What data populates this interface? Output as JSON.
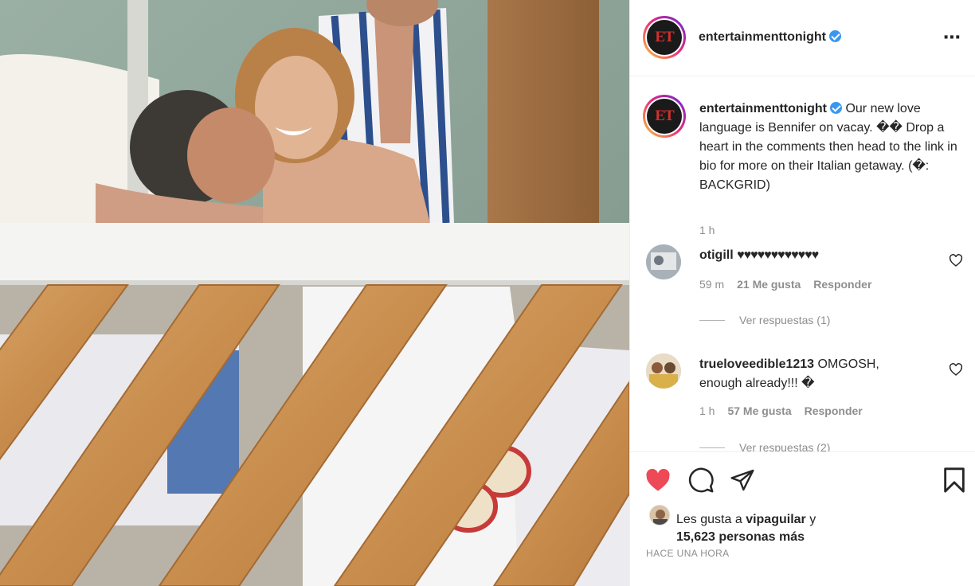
{
  "post": {
    "username": "entertainmenttonight",
    "avatar_text": "ET",
    "more_icon": "⋯",
    "caption_text": "Our new love language is Bennifer on vacay. �� Drop a heart in the comments then head to the link in bio for more on their Italian getaway. (�: BACKGRID)",
    "caption_time": "1 h"
  },
  "comments": [
    {
      "username": "otigill",
      "text": "♥♥♥♥♥♥♥♥♥♥♥♥",
      "time": "59 m",
      "likes": "21 Me gusta",
      "reply": "Responder",
      "view_replies": "Ver respuestas (1)"
    },
    {
      "username": "trueloveedible1213",
      "text": "OMGOSH, enough already!!! �",
      "time": "1 h",
      "likes": "57 Me gusta",
      "reply": "Responder",
      "view_replies": "Ver respuestas (2)"
    }
  ],
  "footer": {
    "liked_by_prefix": "Les gusta a",
    "liked_by_user": "vipaguilar",
    "liked_by_suffix": "y",
    "others_count": "15,623 personas más",
    "timestamp": "HACE UNA HORA"
  },
  "colors": {
    "like_red": "#ed4956",
    "verified_blue": "#3897f0",
    "secondary_text": "#8e8e8e"
  },
  "icons": [
    "verified-badge-icon",
    "more-options-icon",
    "heart-icon",
    "comment-icon",
    "share-icon",
    "bookmark-icon"
  ]
}
